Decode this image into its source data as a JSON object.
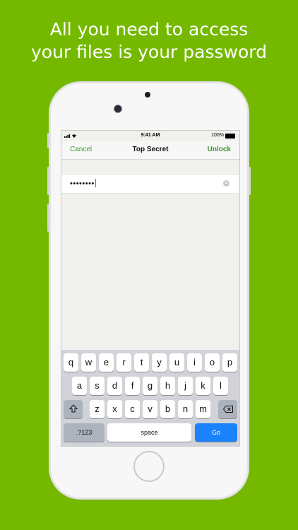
{
  "headline": {
    "line1": "All you need to access",
    "line2": "your files is your password"
  },
  "status_bar": {
    "time": "9:41 AM",
    "battery": "100%"
  },
  "navbar": {
    "cancel": "Cancel",
    "title": "Top Secret",
    "unlock": "Unlock"
  },
  "password_field": {
    "value": "••••••••"
  },
  "keyboard": {
    "row1": [
      "q",
      "w",
      "e",
      "r",
      "t",
      "y",
      "u",
      "i",
      "o",
      "p"
    ],
    "row2": [
      "a",
      "s",
      "d",
      "f",
      "g",
      "h",
      "j",
      "k",
      "l"
    ],
    "row3": [
      "z",
      "x",
      "c",
      "v",
      "b",
      "n",
      "m"
    ],
    "numbers": ".?123",
    "space": "space",
    "go": "Go",
    "shift_icon": "shift-icon",
    "delete_icon": "delete-icon"
  },
  "colors": {
    "background": "#74b900",
    "accent": "#3f9a2b",
    "go_key": "#1a82fb"
  }
}
